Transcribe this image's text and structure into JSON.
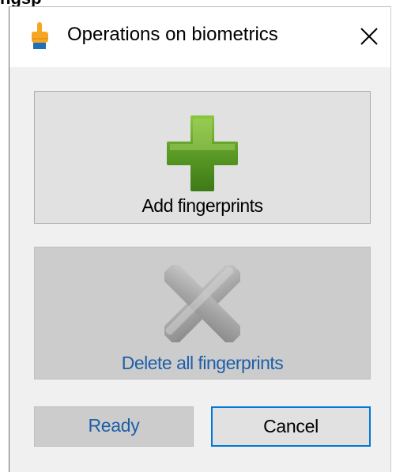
{
  "top_fragment": "ngsp",
  "dialog": {
    "title": "Operations on biometrics",
    "app_icon": "pointing-hand-icon",
    "close_icon": "close-icon"
  },
  "buttons": {
    "add": {
      "label": "Add fingerprints",
      "icon": "plus-icon",
      "enabled": true
    },
    "delete": {
      "label": "Delete all fingerprints",
      "icon": "cross-icon",
      "enabled": false
    },
    "ready": {
      "label": "Ready",
      "enabled": false
    },
    "cancel": {
      "label": "Cancel",
      "enabled": true,
      "focused": true
    }
  },
  "colors": {
    "focus_border": "#0078d7",
    "disabled_text": "#1e5fa8",
    "add_icon_green": "#5b9a26",
    "window_bg": "#f0f0f0"
  }
}
